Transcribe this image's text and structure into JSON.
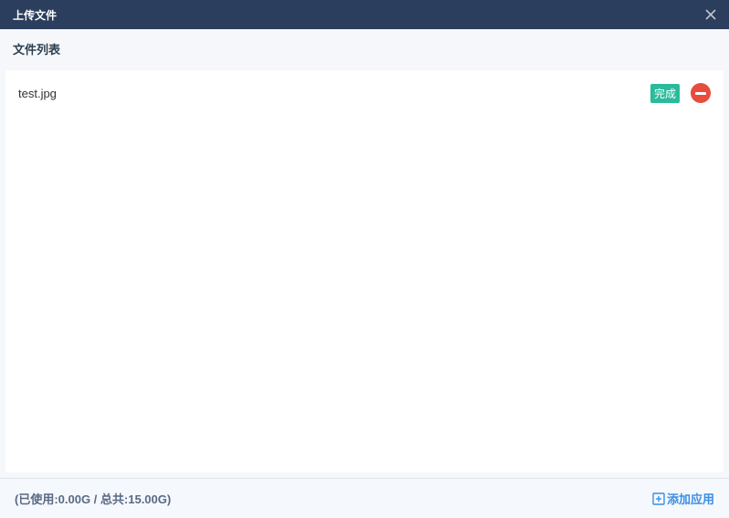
{
  "dialog": {
    "title": "上传文件",
    "section_title": "文件列表"
  },
  "files": [
    {
      "name": "test.jpg",
      "status": "完成"
    }
  ],
  "footer": {
    "storage_text": "(已使用:0.00G / 总共:15.00G)",
    "add_app_label": "添加应用"
  },
  "icons": {
    "close": "close-icon",
    "remove": "minus-circle-icon",
    "plus_box": "plus-box-icon"
  },
  "colors": {
    "header_bg": "#2c3e5d",
    "status_bg": "#2abb9b",
    "remove_bg": "#e74c3c",
    "link": "#3a8ee6"
  }
}
